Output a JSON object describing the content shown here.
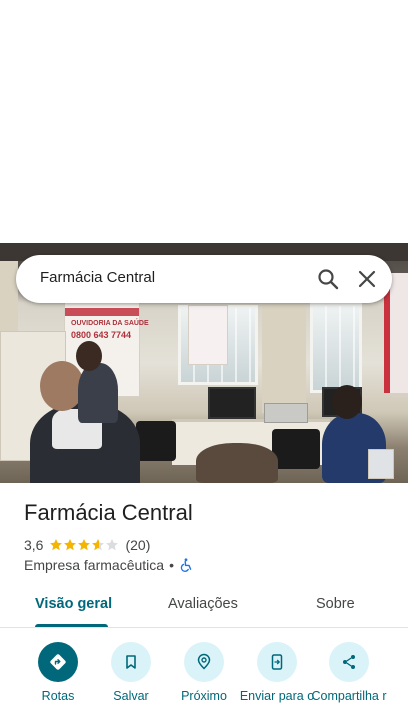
{
  "search": {
    "query": "Farmácia Central"
  },
  "photo": {
    "poster_phone": "0800 643 7744",
    "poster_heading": "OUVIDORIA DA SAÚDE"
  },
  "place": {
    "name": "Farmácia Central",
    "rating": "3,6",
    "rating_stars": 3.6,
    "review_count": "(20)",
    "category": "Empresa farmacêutica",
    "separator": "•"
  },
  "tabs": [
    {
      "label": "Visão geral",
      "active": true
    },
    {
      "label": "Avaliações",
      "active": false
    },
    {
      "label": "Sobre",
      "active": false
    }
  ],
  "actions": [
    {
      "label": "Rotas",
      "icon": "directions-icon"
    },
    {
      "label": "Salvar",
      "icon": "bookmark-icon"
    },
    {
      "label": "Próximo",
      "icon": "nearby-icon"
    },
    {
      "label": "Enviar para o",
      "icon": "send-to-phone-icon"
    },
    {
      "label": "Compartilha r",
      "icon": "share-icon"
    }
  ],
  "colors": {
    "accent": "#00687a",
    "action_bg": "#d9f3f9",
    "star": "#f5b400",
    "star_empty": "#dadce0",
    "wheelchair": "#1a73e8"
  }
}
